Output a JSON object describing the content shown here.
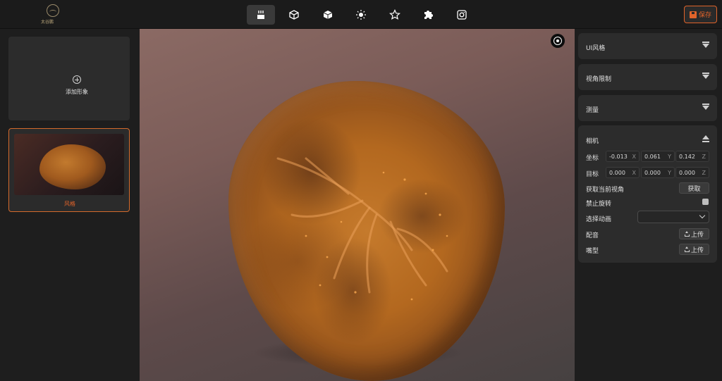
{
  "logo": {
    "text": "太谷鹏"
  },
  "toolbar": {
    "tools": [
      {
        "icon": "scene-icon",
        "active": true
      },
      {
        "icon": "box-icon"
      },
      {
        "icon": "cube-icon"
      },
      {
        "icon": "light-icon"
      },
      {
        "icon": "star-icon"
      },
      {
        "icon": "plugin-icon"
      },
      {
        "icon": "camera-icon"
      }
    ],
    "save_label": "保存"
  },
  "left": {
    "add_label": "添加形象",
    "style_label": "风格"
  },
  "right": {
    "sections": [
      "UI风格",
      "视角限制",
      "测量"
    ],
    "camera": {
      "title": "相机",
      "position_label": "坐标",
      "position": {
        "x": "-0.013",
        "y": "0.061",
        "z": "0.142"
      },
      "target_label": "目标",
      "target": {
        "x": "0.000",
        "y": "0.000",
        "z": "0.000"
      },
      "axis_x": "X",
      "axis_y": "Y",
      "axis_z": "Z",
      "get_view_label": "获取当前视角",
      "get_button": "获取",
      "disable_rotation_label": "禁止旋转",
      "select_animation_label": "选择动画",
      "select_animation_value": "",
      "audio_label": "配音",
      "mouth_label": "嘴型",
      "upload_label": "上传"
    }
  }
}
